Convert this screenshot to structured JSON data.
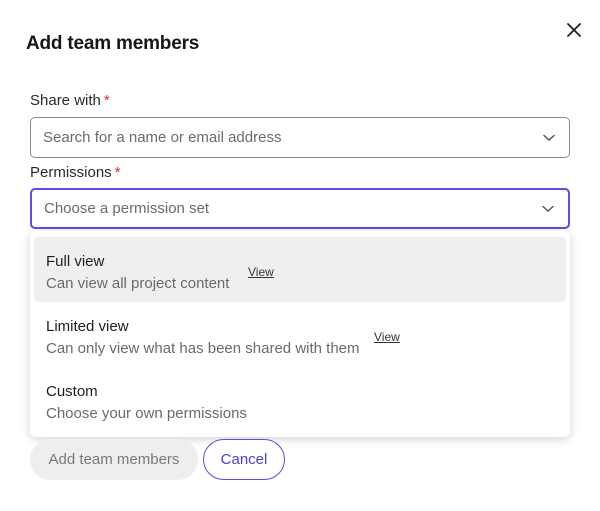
{
  "dialog": {
    "title": "Add team members",
    "close_icon": "close-icon"
  },
  "share_with": {
    "label": "Share with",
    "required_mark": "*",
    "placeholder": "Search for a name or email address"
  },
  "permissions": {
    "label": "Permissions",
    "required_mark": "*",
    "placeholder": "Choose a permission set",
    "options": [
      {
        "title": "Full view",
        "description": "Can view all project content",
        "link": "View"
      },
      {
        "title": "Limited view",
        "description": "Can only view what has been shared with them",
        "link": "View"
      },
      {
        "title": "Custom",
        "description": "Choose your own permissions"
      }
    ]
  },
  "buttons": {
    "add": "Add team members",
    "cancel": "Cancel"
  },
  "colors": {
    "accent": "#5b4fe0",
    "required": "#d0302f",
    "hover_bg": "#efefef"
  }
}
